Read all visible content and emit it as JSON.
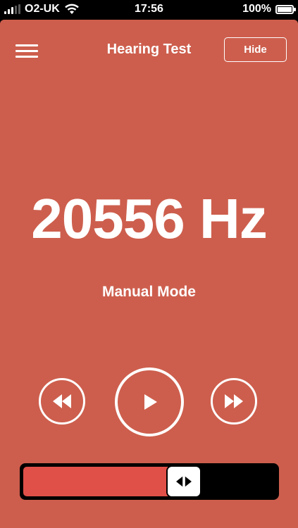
{
  "status_bar": {
    "carrier": "O2-UK",
    "time": "17:56",
    "battery": "100%"
  },
  "header": {
    "title": "Hearing Test",
    "hide_label": "Hide"
  },
  "display": {
    "frequency": "20556 Hz",
    "mode": "Manual Mode"
  },
  "controls": {
    "rewind_icon": "rewind-icon",
    "play_icon": "play-icon",
    "forward_icon": "fast-forward-icon"
  },
  "slider": {
    "value": 0.66,
    "handle_icon": "left-right-arrows-icon",
    "fill_color": "#e05048"
  },
  "colors": {
    "background": "#cd5e4d",
    "foreground": "#ffffff"
  }
}
